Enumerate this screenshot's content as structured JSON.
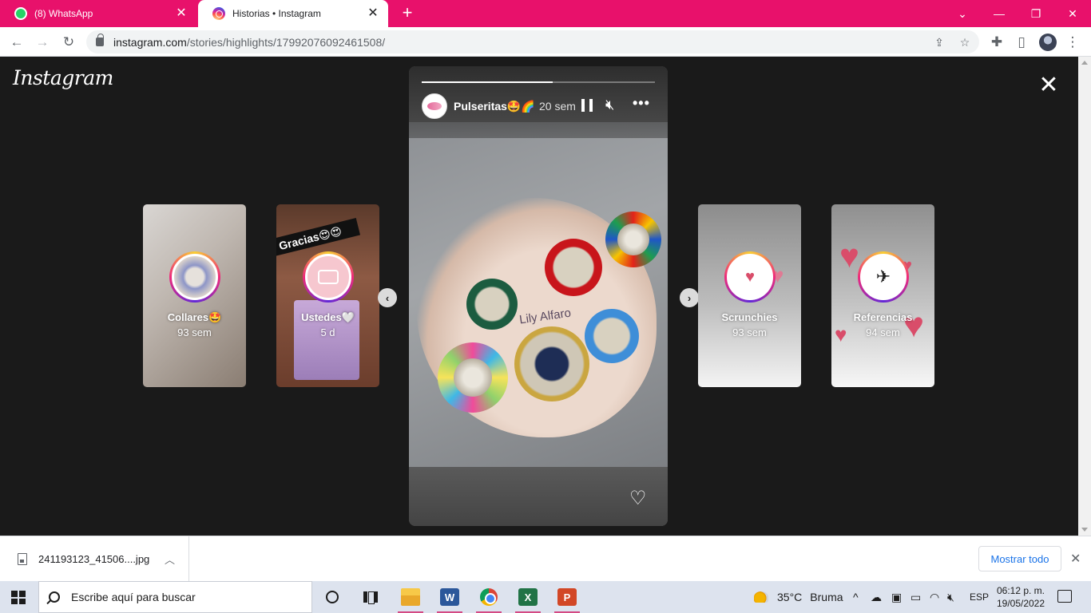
{
  "browser": {
    "tabs": [
      {
        "title": "(8) WhatsApp",
        "close": "✕"
      },
      {
        "title": "Historias • Instagram",
        "close": "✕"
      }
    ],
    "new_tab": "+",
    "window_controls": {
      "dropdown": "⌄",
      "minimize": "—",
      "restore": "❐",
      "close": "✕"
    },
    "url_host": "instagram.com",
    "url_path": "/stories/highlights/17992076092461508/"
  },
  "instagram": {
    "logo": "Instagram",
    "close": "✕",
    "story": {
      "username": "Pulseritas🤩🌈",
      "age": "20 sem",
      "progress_fraction": 0.56,
      "watermark": "Lily Alfaro"
    },
    "highlights": [
      {
        "name": "Collares🤩",
        "age": "93 sem"
      },
      {
        "name": "Ustedes🤍",
        "age": "5 d",
        "banner": "Gracias😍😍"
      },
      {
        "name": "Scrunchies",
        "age": "93 sem"
      },
      {
        "name": "Referencias",
        "age": "94 sem"
      }
    ],
    "prev_arrow": "‹",
    "next_arrow": "›"
  },
  "downloads": {
    "file_name": "241193123_41506....jpg",
    "show_all": "Mostrar todo"
  },
  "taskbar": {
    "search_placeholder": "Escribe aquí para buscar",
    "weather_temp": "35°C",
    "weather_desc": "Bruma",
    "language": "ESP",
    "time": "06:12 p. m.",
    "date": "19/05/2022"
  },
  "colors": {
    "theme": "#e8116b",
    "instagram_bg": "#1a1a1a"
  }
}
